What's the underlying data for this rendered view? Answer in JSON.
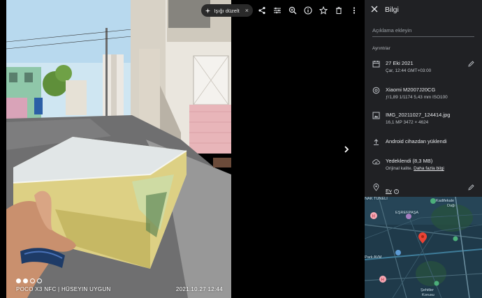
{
  "watermark": {
    "device_line": "POCO X3 NFC | HÜSEYIN UYGUN",
    "timestamp": "2021.10.27 12:44"
  },
  "toolbar": {
    "enhance_label": "Işığı düzelt",
    "enhance_close": "×",
    "icons": [
      "share-icon",
      "adjust-icon",
      "zoom-icon",
      "info-icon",
      "star-icon",
      "delete-icon",
      "more-icon"
    ]
  },
  "panel": {
    "title": "Bilgi",
    "caption_placeholder": "Açıklama ekleyin",
    "details_label": "Ayrıntılar",
    "date": {
      "primary": "27 Eki 2021",
      "secondary": "Çar, 12:44   GMT+03:00"
    },
    "camera": {
      "primary": "Xiaomi M2007J20CG",
      "secondary": "ƒ/1,89   1/1174   5,43 mm   ISO100"
    },
    "file": {
      "primary": "IMG_20211027_124414.jpg",
      "secondary": "16,1 MP   3472 × 4624"
    },
    "upload": {
      "primary": "Android cihazdan yüklendi"
    },
    "backup": {
      "primary": "Yedeklendi (8,3 MB)",
      "secondary_prefix": "Orijinal kalite.",
      "secondary_link": "Daha fazla bilgi"
    },
    "location": {
      "label": "Ev"
    }
  },
  "map": {
    "labels": {
      "top_left": "NAK TÜNELİ",
      "kadifekale": "Kadifekale",
      "kadifekale2": "Dağı",
      "esrefpasa": "EŞREFPAŞA",
      "park": "Park AVM",
      "sehitler": "Şehitler",
      "sehitler2": "Korusu"
    }
  },
  "colors": {
    "panel_bg": "#202124",
    "pin": "#ea4335",
    "map_bg": "#1f3a4a"
  }
}
